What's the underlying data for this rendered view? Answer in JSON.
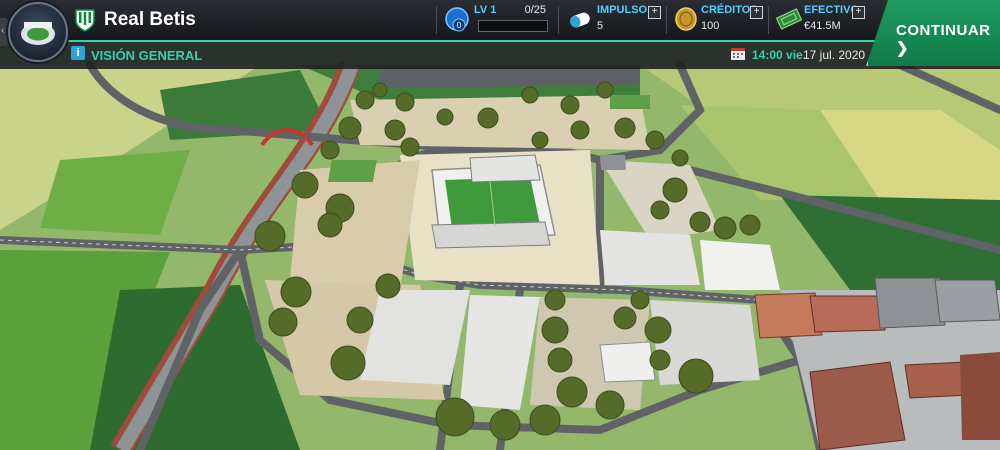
{
  "club": {
    "name": "Real Betis",
    "crest_icon": "betis-crest-icon",
    "badge_icon": "stadium-badge-icon"
  },
  "stats": {
    "level": {
      "label": "LV 1",
      "count": "0/25",
      "progress": 0,
      "badge_value": "0",
      "icon": "level-shield-icon"
    },
    "boost": {
      "label": "IMPULSO",
      "value": "5",
      "icon": "boost-pills-icon"
    },
    "credits": {
      "label": "CRÉDITOS",
      "value": "100",
      "icon": "coin-icon"
    },
    "cash": {
      "label": "EFECTIVO",
      "value": "€41.5M",
      "icon": "cash-icon"
    },
    "plus_symbol": "+"
  },
  "continue_button": {
    "label": "CONTINUAR ❯"
  },
  "subheader": {
    "section_icon": "i",
    "section": "VISIÓN GENERAL",
    "time": "14:00 vie.",
    "date": "17 jul. 2020"
  },
  "colors": {
    "accent": "#2fd3b0",
    "stat_label": "#4fd1ff",
    "continue": "#1f9c61"
  }
}
